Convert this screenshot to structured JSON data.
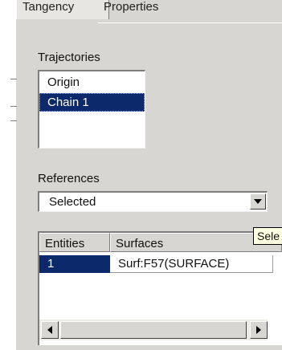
{
  "tabs": [
    "Tangency",
    "Properties"
  ],
  "trajectories": {
    "label": "Trajectories",
    "items": [
      "Origin",
      "Chain 1"
    ],
    "selected_index": 1
  },
  "references": {
    "label": "References",
    "selected": "Selected"
  },
  "table": {
    "columns": [
      "Entities",
      "Surfaces"
    ],
    "rows": [
      [
        "1",
        "Surf:F57(SURFACE)"
      ]
    ]
  },
  "tooltip": "Sele",
  "icons": {
    "dropdown": "chevron-down-icon",
    "scroll_left": "arrow-left-icon",
    "scroll_right": "arrow-right-icon"
  }
}
